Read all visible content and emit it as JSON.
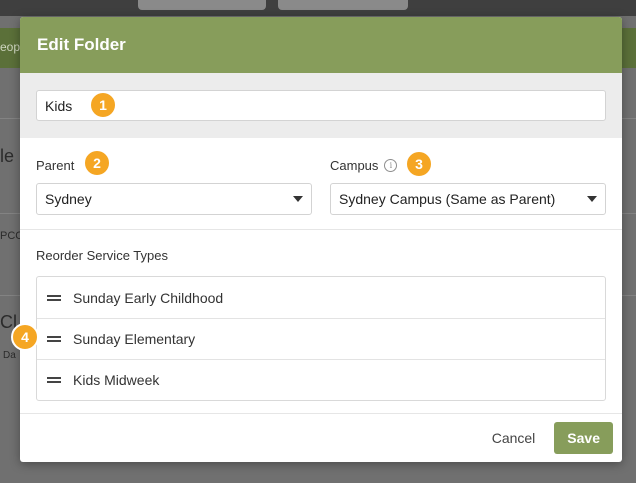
{
  "background": {
    "partial_text": [
      "eop",
      "le",
      "PCO",
      "Cl",
      "Da"
    ]
  },
  "modal": {
    "title": "Edit Folder",
    "name_value": "Kids",
    "parent": {
      "label": "Parent",
      "value": "Sydney"
    },
    "campus": {
      "label": "Campus",
      "value": "Sydney Campus (Same as Parent)",
      "info_icon": "info-circle-icon"
    },
    "reorder": {
      "label": "Reorder Service Types",
      "items": [
        "Sunday Early Childhood",
        "Sunday Elementary",
        "Kids Midweek"
      ]
    },
    "footer": {
      "cancel_label": "Cancel",
      "save_label": "Save"
    }
  },
  "callouts": [
    "1",
    "2",
    "3",
    "4"
  ],
  "colors": {
    "accent_green": "#879d5b",
    "callout_orange": "#f5a623"
  }
}
